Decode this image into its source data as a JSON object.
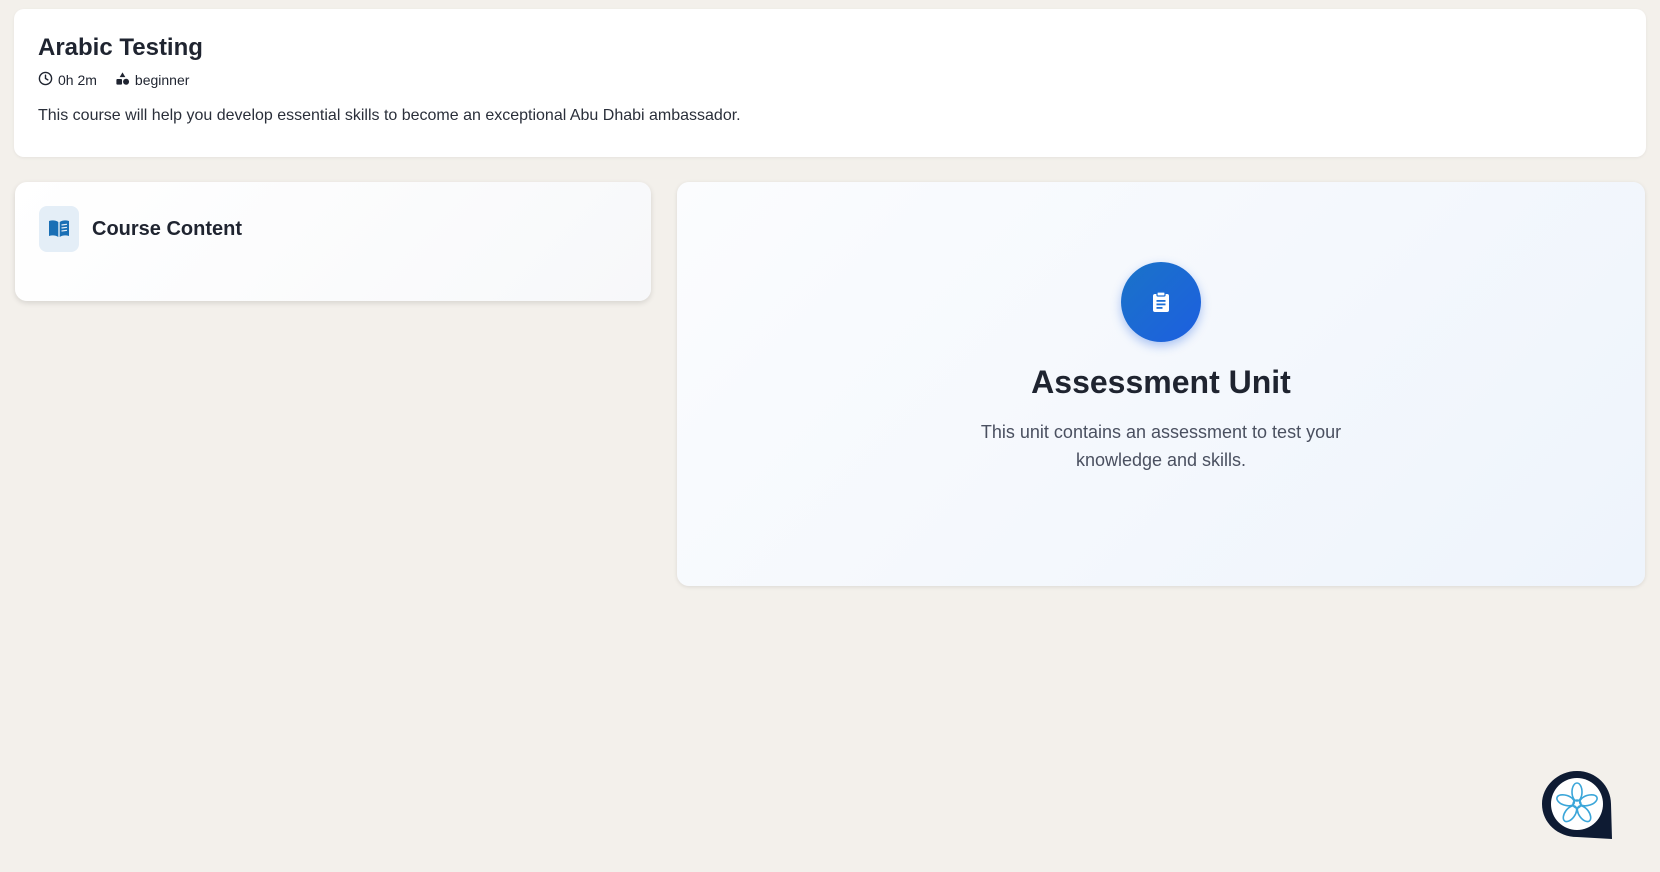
{
  "course": {
    "title": "Arabic Testing",
    "duration": "0h 2m",
    "level": "beginner",
    "description": "This course will help you develop essential skills to become an exceptional Abu Dhabi ambassador."
  },
  "course_content": {
    "title": "Course Content"
  },
  "assessment": {
    "title": "Assessment Unit",
    "description": "This unit contains an assessment to test your knowledge and skills."
  },
  "icons": {
    "duration": "clock-icon",
    "level": "shapes-icon",
    "course_content": "book-icon",
    "assessment": "clipboard-icon",
    "chat": "chat-assistant-icon"
  },
  "colors": {
    "background": "#f3f0eb",
    "accent": "#1d6fd6",
    "text": "#1f2430"
  }
}
